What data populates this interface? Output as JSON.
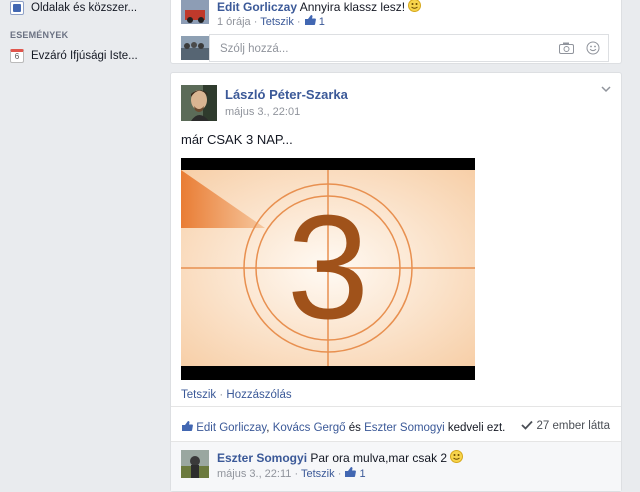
{
  "sidebar": {
    "items": [
      {
        "label": "Oldalak és közszer...",
        "icon": "pages-icon"
      },
      {
        "label": "Évzáró Ifjúsági Iste...",
        "icon": "calendar-icon"
      }
    ],
    "section_events": "ESEMÉNYEK",
    "calendar_day": "6"
  },
  "top_comment": {
    "author": "Edit Gorliczay",
    "text": "Annyira klassz lesz!",
    "emoji": "smile-emoji",
    "time": "1 órája",
    "like_label": "Tetszik",
    "like_count": "1"
  },
  "comment_input": {
    "placeholder": "Szólj hozzá..."
  },
  "post": {
    "author": "László Péter-Szarka",
    "time": "május 3., 22:01",
    "text": "már CSAK 3 NAP...",
    "video_number": "3",
    "actions": {
      "like": "Tetszik",
      "separator": "·",
      "comment": "Hozzászólás"
    },
    "likes": {
      "people": [
        "Edit Gorliczay",
        "Kovács Gergő",
        "Eszter Somogyi"
      ],
      "sep1": ", ",
      "sep2": " és ",
      "suffix": " kedveli ezt."
    },
    "seen": "27 ember látta"
  },
  "post_comment": {
    "author": "Eszter Somogyi",
    "text": "Par ora mulva,mar csak 2",
    "emoji": "smile-emoji",
    "time": "május 3., 22:11",
    "like_label": "Tetszik",
    "like_count": "1"
  },
  "colors": {
    "link": "#3b5998",
    "background": "#e9ebee",
    "countdown_orange": "#e8782e",
    "countdown_brown": "#a0521a"
  }
}
